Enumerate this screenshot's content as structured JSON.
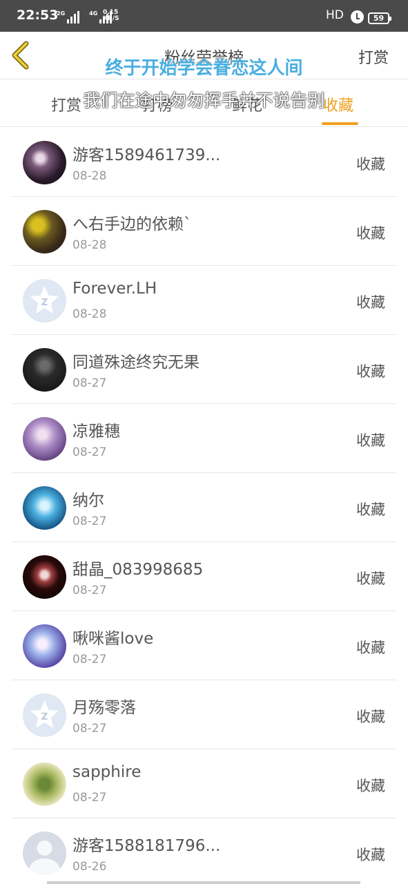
{
  "status_bar": {
    "time": "22:53",
    "net1": "2G",
    "net2": "4G",
    "speed_value": "0.15",
    "speed_unit": "KB/S",
    "hd": "HD",
    "battery": "59"
  },
  "nav": {
    "title": "粉丝荣誉榜",
    "right_label": "打赏"
  },
  "tabs": [
    {
      "label": "打赏"
    },
    {
      "label": "打榜"
    },
    {
      "label": "鲜花"
    },
    {
      "label": "收藏"
    }
  ],
  "lyrics": {
    "line1": "终于开始学会眷恋这人间",
    "line2": "我们在途中匆匆挥手并不说告别"
  },
  "rows": [
    {
      "name": "游客1589461739...",
      "date": "08-28",
      "action": "收藏",
      "avatar": "dark-anime-avatar"
    },
    {
      "name": "へ右手边的依赖ˋ",
      "date": "08-28",
      "action": "收藏",
      "avatar": "yellow-character-avatar"
    },
    {
      "name": "Forever.LH",
      "date": "08-28",
      "action": "收藏",
      "avatar": "default-q-avatar"
    },
    {
      "name": "同道殊途终究无果",
      "date": "08-27",
      "action": "收藏",
      "avatar": "masked-person-avatar"
    },
    {
      "name": "凉雅穗",
      "date": "08-27",
      "action": "收藏",
      "avatar": "purple-anime-avatar"
    },
    {
      "name": "纳尔",
      "date": "08-27",
      "action": "收藏",
      "avatar": "blue-anime-avatar"
    },
    {
      "name": "甜晶_083998685",
      "date": "08-27",
      "action": "收藏",
      "avatar": "dark-doll-avatar"
    },
    {
      "name": "啾咪酱love",
      "date": "08-27",
      "action": "收藏",
      "avatar": "blue-purple-anime-avatar"
    },
    {
      "name": "月殇零落",
      "date": "08-27",
      "action": "收藏",
      "avatar": "default-q-avatar"
    },
    {
      "name": "sapphire",
      "date": "08-27",
      "action": "收藏",
      "avatar": "plant-avatar"
    },
    {
      "name": "游客1588181796...",
      "date": "08-26",
      "action": "收藏",
      "avatar": "default-person-avatar"
    }
  ],
  "colors": {
    "accent": "#f0a020",
    "lyric_blue": "#4aaee0",
    "status_bar": "#4a4a4a"
  }
}
